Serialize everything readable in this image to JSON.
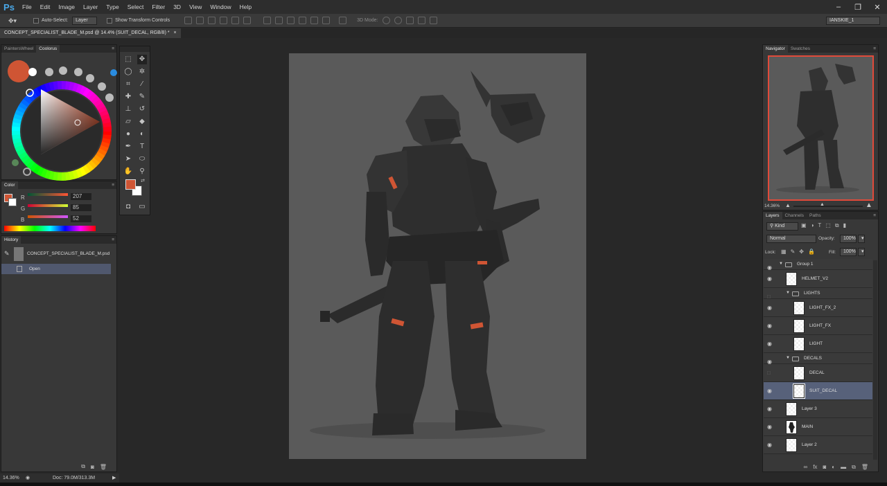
{
  "app": {
    "logo": "Ps"
  },
  "menu": [
    "File",
    "Edit",
    "Image",
    "Layer",
    "Type",
    "Select",
    "Filter",
    "3D",
    "View",
    "Window",
    "Help"
  ],
  "window_controls": {
    "minimize": "–",
    "restore": "❐",
    "close": "✕"
  },
  "options_bar": {
    "auto_select_label": "Auto-Select:",
    "auto_select_value": "Layer",
    "show_transform_label": "Show Transform Controls",
    "mode_3d_label": "3D Mode:",
    "workspace": "IANSKIE_1"
  },
  "document": {
    "tab_title": "CONCEPT_SPECIALIST_BLADE_M.psd @ 14.4% (SUIT_DECAL, RGB/8) *",
    "close": "×"
  },
  "painters_wheel": {
    "tabs": [
      "PaintersWheel",
      "Coolorus"
    ],
    "active_tab": "Coolorus",
    "foreground_color": "#cf5534"
  },
  "color_panel": {
    "title": "Color",
    "r_label": "R",
    "r_value": "207",
    "g_label": "G",
    "g_value": "85",
    "b_label": "B",
    "b_value": "52"
  },
  "history": {
    "title": "History",
    "snapshot": "CONCEPT_SPECIALIST_BLADE_M.psd",
    "items": [
      "Open"
    ]
  },
  "navigator": {
    "tabs": [
      "Navigator",
      "Swatches"
    ],
    "active_tab": "Navigator",
    "zoom": "14.36%"
  },
  "layers_panel": {
    "tabs": [
      "Layers",
      "Channels",
      "Paths"
    ],
    "active_tab": "Layers",
    "filter": "Kind",
    "blend_mode": "Normal",
    "opacity_label": "Opacity:",
    "opacity": "100%",
    "lock_label": "Lock:",
    "fill_label": "Fill:",
    "fill": "100%",
    "rows": [
      {
        "type": "group",
        "name": "Group 1",
        "depth": 0,
        "visible": true
      },
      {
        "type": "layer",
        "name": "HELMET_V2",
        "depth": 1,
        "visible": true
      },
      {
        "type": "group",
        "name": "LIGHTS",
        "depth": 1,
        "visible": false
      },
      {
        "type": "layer",
        "name": "LIGHT_FX_2",
        "depth": 2,
        "visible": true
      },
      {
        "type": "layer",
        "name": "LIGHT_FX",
        "depth": 2,
        "visible": true
      },
      {
        "type": "layer",
        "name": "LIGHT",
        "depth": 2,
        "visible": true
      },
      {
        "type": "group",
        "name": "DECALS",
        "depth": 1,
        "visible": true
      },
      {
        "type": "layer",
        "name": "DECAL",
        "depth": 2,
        "visible": false
      },
      {
        "type": "layer",
        "name": "SUIT_DECAL",
        "depth": 2,
        "visible": true,
        "selected": true
      },
      {
        "type": "layer",
        "name": "Layer 3",
        "depth": 1,
        "visible": true
      },
      {
        "type": "layer",
        "name": "MAIN",
        "depth": 1,
        "visible": true,
        "silhouette": true
      },
      {
        "type": "layer",
        "name": "Layer 2",
        "depth": 1,
        "visible": true
      }
    ]
  },
  "status_bar": {
    "zoom": "14.36%",
    "doc_info": "Doc: 79.0M/313.3M"
  },
  "colors": {
    "accent_orange": "#cf5534",
    "selection_blue": "#57617a",
    "canvas_gray": "#5a5a5a",
    "armor_dark": "#2b2b2b"
  }
}
